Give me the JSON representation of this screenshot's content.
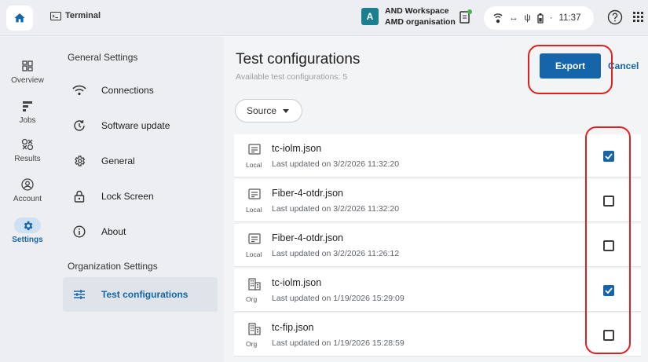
{
  "topbar": {
    "app_title": "Terminal",
    "workspace_badge": "A",
    "workspace_name": "AND Workspace",
    "workspace_org": "AMD organisation",
    "clock": "11:37",
    "battery_sep": "·"
  },
  "leftnav": {
    "items": [
      {
        "label": "Overview",
        "icon": "dashboard-icon"
      },
      {
        "label": "Jobs",
        "icon": "jobs-icon"
      },
      {
        "label": "Results",
        "icon": "results-icon"
      },
      {
        "label": "Account",
        "icon": "account-icon"
      },
      {
        "label": "Settings",
        "icon": "gear-icon",
        "active": true
      }
    ]
  },
  "menu": {
    "general_heading": "General Settings",
    "items": [
      {
        "label": "Connections",
        "icon": "wifi-icon"
      },
      {
        "label": "Software update",
        "icon": "update-icon"
      },
      {
        "label": "General",
        "icon": "gear-icon"
      },
      {
        "label": "Lock Screen",
        "icon": "lock-icon"
      },
      {
        "label": "About",
        "icon": "info-icon"
      }
    ],
    "org_heading": "Organization Settings",
    "org_items": [
      {
        "label": "Test configurations",
        "icon": "sliders-icon",
        "active": true
      }
    ]
  },
  "main": {
    "title": "Test configurations",
    "subtitle": "Available test configurations: 5",
    "export_label": "Export",
    "cancel_label": "Cancel",
    "source_label": "Source",
    "configs": [
      {
        "name": "tc-iolm.json",
        "source": "Local",
        "updated": "Last updated on 3/2/2026 11:32:20",
        "checked": true
      },
      {
        "name": "Fiber-4-otdr.json",
        "source": "Local",
        "updated": "Last updated on 3/2/2026 11:32:20",
        "checked": false
      },
      {
        "name": "Fiber-4-otdr.json",
        "source": "Local",
        "updated": "Last updated on 3/2/2026 11:26:12",
        "checked": false
      },
      {
        "name": "tc-iolm.json",
        "source": "Org",
        "updated": "Last updated on 1/19/2026 15:29:09",
        "checked": true
      },
      {
        "name": "tc-fip.json",
        "source": "Org",
        "updated": "Last updated on 1/19/2026 15:28:59",
        "checked": false
      }
    ]
  },
  "colors": {
    "accent": "#1565a8",
    "highlight": "#e0201f"
  }
}
